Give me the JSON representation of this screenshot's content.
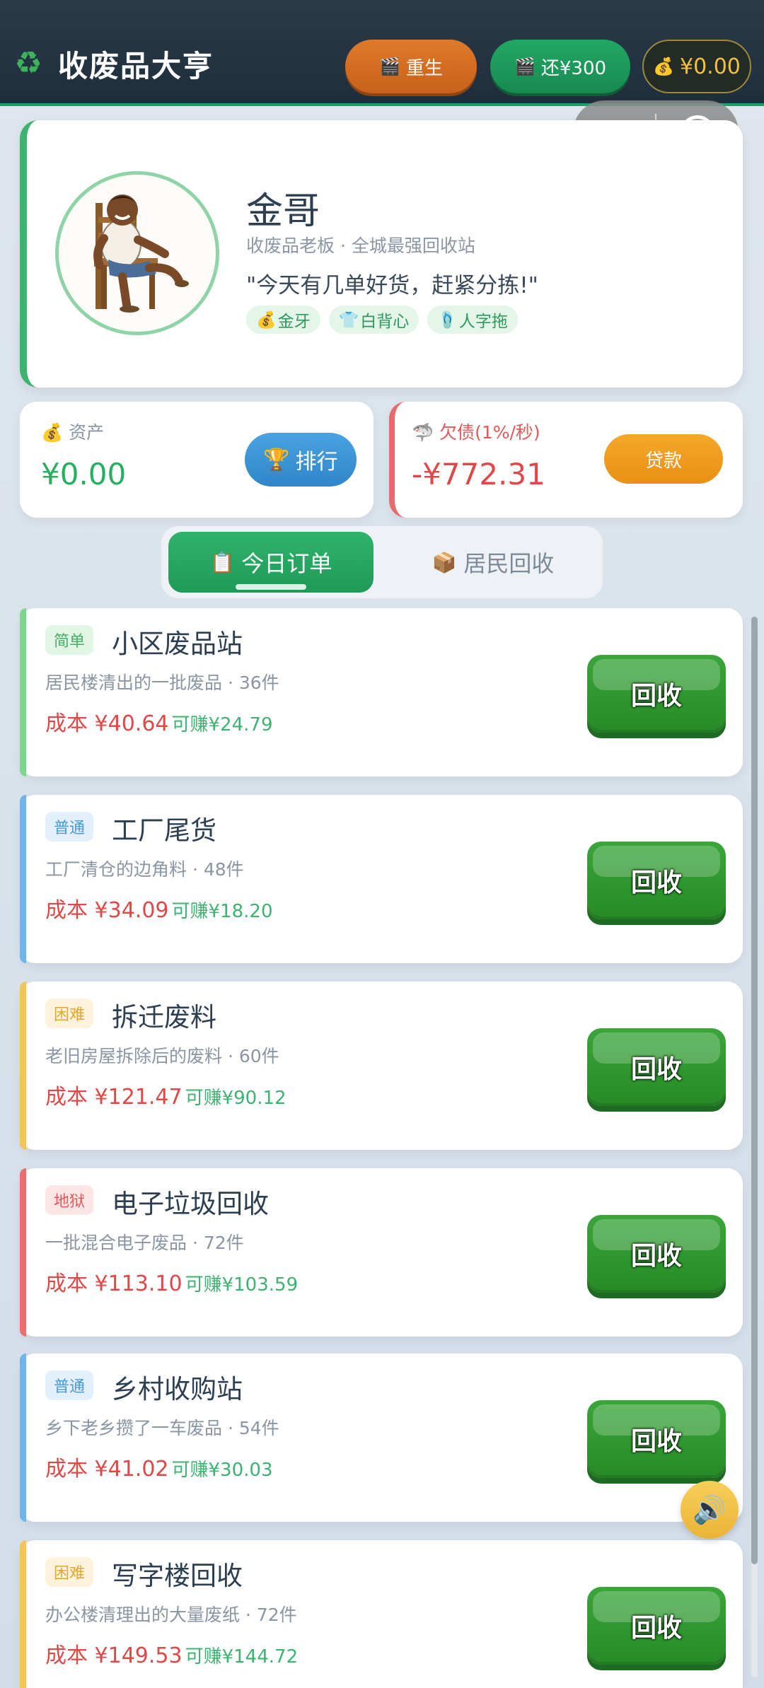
{
  "header": {
    "logo_icon": "♻",
    "title": "收废品大亨",
    "rebirth_label": "重生",
    "repay_label": "还¥300",
    "money_label": "¥0.00",
    "video_icon": "🎬",
    "money_icon": "💰"
  },
  "capsule": {
    "more": "•••"
  },
  "profile": {
    "name": "金哥",
    "subtitle": "收废品老板 · 全城最强回收站",
    "quote": "\"今天有几单好货，赶紧分拣!\"",
    "tags": [
      {
        "icon": "💰",
        "label": "金牙"
      },
      {
        "icon": "👕",
        "label": "白背心"
      },
      {
        "icon": "🩴",
        "label": "人字拖"
      }
    ]
  },
  "stats": {
    "assets": {
      "icon": "💰",
      "label": "资产",
      "value": "¥0.00",
      "button_icon": "🏆",
      "button": "排行"
    },
    "debt": {
      "icon": "🦈",
      "label": "欠债(1%/秒)",
      "value": "-¥772.31",
      "button": "贷款"
    }
  },
  "tabs": [
    {
      "icon": "📋",
      "label": "今日订单",
      "active": true
    },
    {
      "icon": "📦",
      "label": "居民回收",
      "active": false
    }
  ],
  "orders": [
    {
      "difficulty": "简单",
      "title": "小区废品站",
      "desc": "居民楼清出的一批废品 · 36件",
      "cost": "成本 ¥40.64",
      "profit": "可赚¥24.79",
      "button": "回收"
    },
    {
      "difficulty": "普通",
      "title": "工厂尾货",
      "desc": "工厂清仓的边角料 · 48件",
      "cost": "成本 ¥34.09",
      "profit": "可赚¥18.20",
      "button": "回收"
    },
    {
      "difficulty": "困难",
      "title": "拆迁废料",
      "desc": "老旧房屋拆除后的废料 · 60件",
      "cost": "成本 ¥121.47",
      "profit": "可赚¥90.12",
      "button": "回收"
    },
    {
      "difficulty": "地狱",
      "title": "电子垃圾回收",
      "desc": "一批混合电子废品 · 72件",
      "cost": "成本 ¥113.10",
      "profit": "可赚¥103.59",
      "button": "回收"
    },
    {
      "difficulty": "普通",
      "title": "乡村收购站",
      "desc": "乡下老乡攒了一车废品 · 54件",
      "cost": "成本 ¥41.02",
      "profit": "可赚¥30.03",
      "button": "回收"
    },
    {
      "difficulty": "困难",
      "title": "写字楼回收",
      "desc": "办公楼清理出的大量废纸 · 72件",
      "cost": "成本 ¥149.53",
      "profit": "可赚¥144.72",
      "button": "回收"
    }
  ],
  "colors": {
    "easy": "#7ed68c",
    "normal": "#6fb4ea",
    "hard": "#f2c45a",
    "hell": "#ea7070",
    "accent": "#1aa06a"
  },
  "sound_icon": "🔊"
}
